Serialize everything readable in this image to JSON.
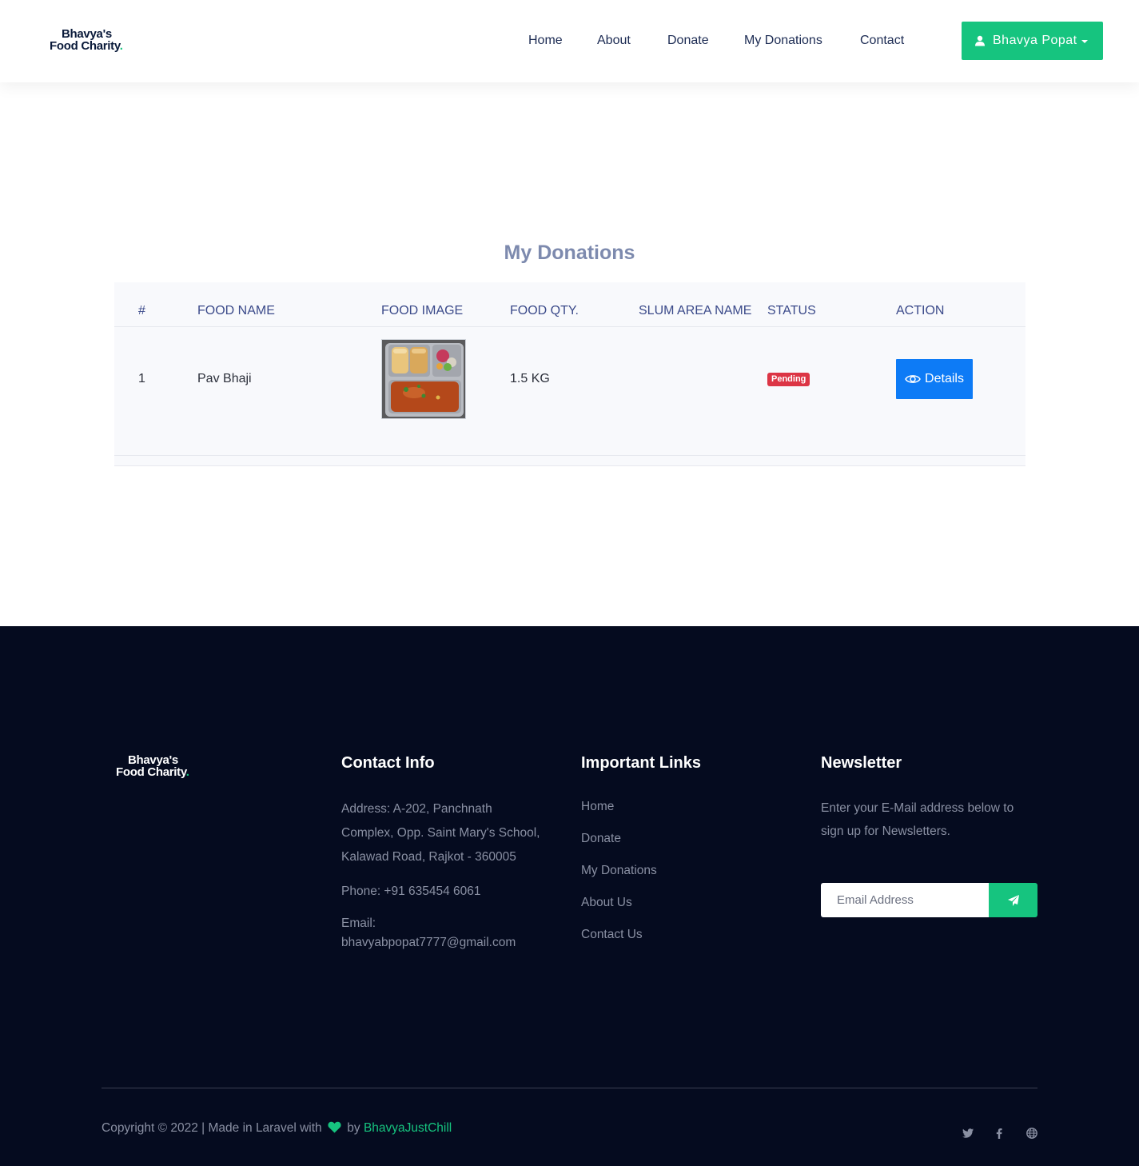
{
  "header": {
    "logo_line1": "Bhavya's",
    "logo_line2": "Food Charity",
    "logo_dot": ".",
    "nav": [
      "Home",
      "About",
      "Donate",
      "My Donations",
      "Contact"
    ],
    "user_name": "Bhavya Popat"
  },
  "main": {
    "title": "My Donations",
    "columns": [
      "#",
      "FOOD NAME",
      "FOOD IMAGE",
      "FOOD QTY.",
      "SLUM AREA NAME",
      "STATUS",
      "ACTION"
    ],
    "rows": [
      {
        "index": "1",
        "food_name": "Pav Bhaji",
        "food_qty": "1.5 KG",
        "slum_area_name": "",
        "status": "Pending",
        "action": "Details"
      }
    ]
  },
  "footer": {
    "logo_line1": "Bhavya's",
    "logo_line2": "Food Charity",
    "logo_dot": ".",
    "contact": {
      "heading": "Contact Info",
      "address_l1": "Address: A-202, Panchnath",
      "address_l2": "Complex, Opp. Saint Mary's School,",
      "address_l3": "Kalawad Road, Rajkot - 360005",
      "phone": "Phone: +91 635454 6061",
      "email_label": "Email:",
      "email": "bhavyabpopat7777@gmail.com"
    },
    "links": {
      "heading": "Important Links",
      "items": [
        "Home",
        "Donate",
        "My Donations",
        "About Us",
        "Contact Us"
      ]
    },
    "newsletter": {
      "heading": "Newsletter",
      "text_l1": "Enter your E-Mail address below to",
      "text_l2": "sign up for Newsletters.",
      "placeholder": "Email Address"
    },
    "copyright_pre": "Copyright © 2022 | Made in Laravel with",
    "copyright_by": "by",
    "copyright_author": "BhavyaJustChill",
    "social_icons": [
      "twitter-icon",
      "facebook-icon",
      "globe-icon"
    ]
  },
  "colors": {
    "accent": "#16c47f",
    "primary_button": "#0d7bf6",
    "danger": "#dc3545",
    "footer_bg": "#050b1f"
  }
}
